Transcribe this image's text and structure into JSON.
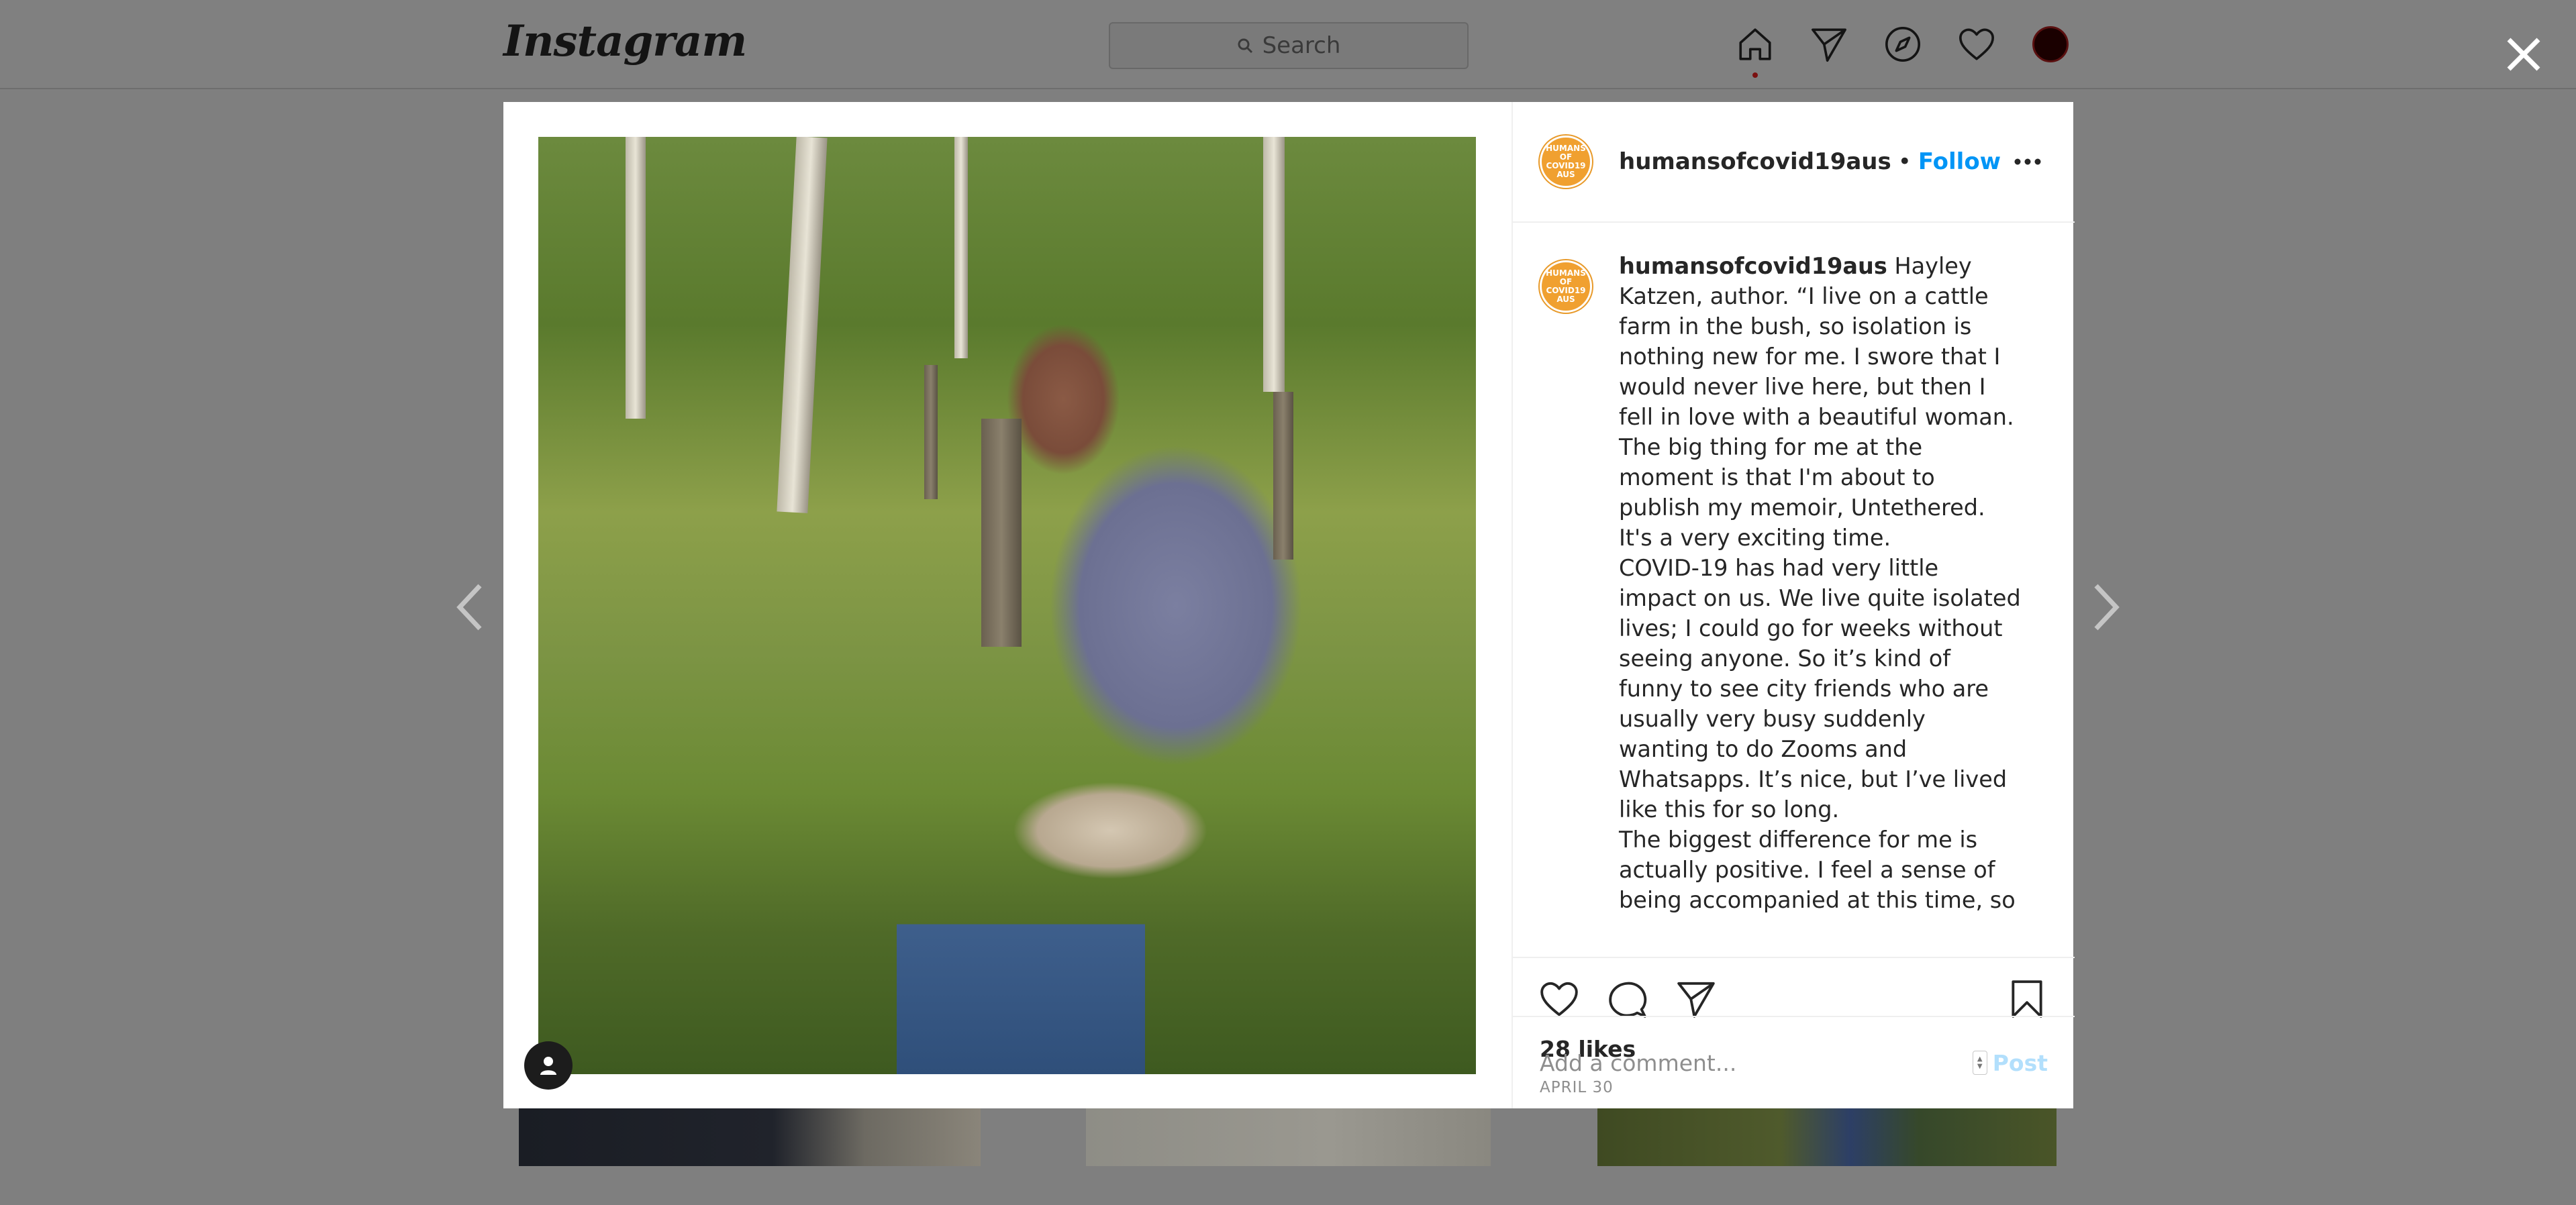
{
  "topnav": {
    "logo": "Instagram",
    "search_placeholder": "Search",
    "icons": [
      "home-icon",
      "direct-icon",
      "explore-icon",
      "activity-icon",
      "profile-avatar"
    ]
  },
  "modal": {
    "header": {
      "username": "humansofcovid19aus",
      "separator": "•",
      "follow_label": "Follow",
      "badge_text": "HUMANS OF COVID19 AUS"
    },
    "caption": {
      "username": "humansofcovid19aus",
      "paragraphs": [
        "Hayley Katzen, author. “I live on a cattle farm in the bush, so isolation is nothing new for me. I swore that I would never live here, but then I fell in love with a beautiful woman. The big thing for me at the moment is that I'm about to publish my memoir, Untethered. It's a very exciting time.",
        "COVID-19 has had very little impact on us. We live quite isolated lives; I could go for weeks without seeing anyone. So it’s kind of funny to see city friends who are usually very busy suddenly wanting to do Zooms and Whatsapps. It’s nice, but I’ve lived like this for so long.",
        "The biggest difference for me is actually positive. I feel a sense of being accompanied at this time, so"
      ]
    },
    "likes": "28 likes",
    "date": "APRIL 30",
    "comment_placeholder": "Add a comment...",
    "post_label": "Post"
  },
  "colors": {
    "accent": "#0095f6",
    "post_disabled": "#b2dffc",
    "overlay": "#7f7f7f"
  }
}
